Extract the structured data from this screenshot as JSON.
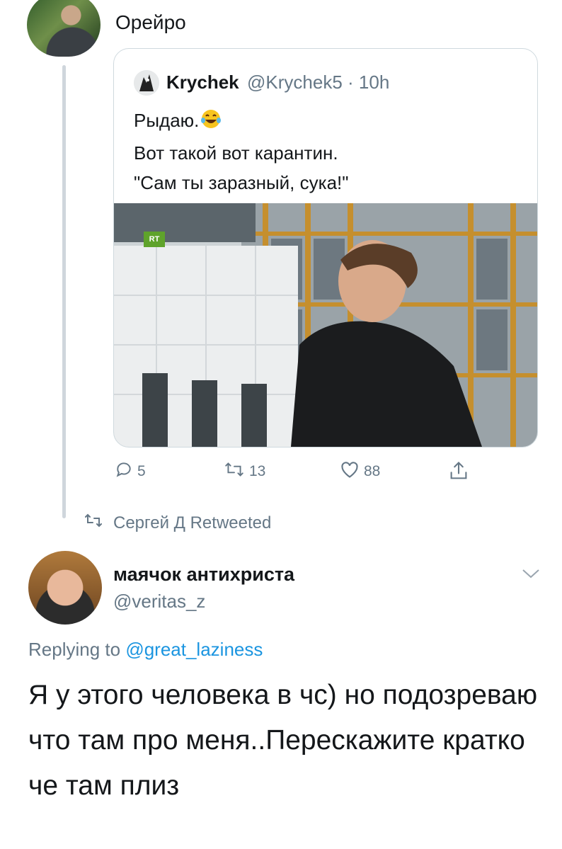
{
  "top_tweet": {
    "name": "Орейро"
  },
  "quoted_tweet": {
    "author_name": "Krychek",
    "author_handle": "@Krychek5",
    "time": "· 10h",
    "text_line1": "Рыдаю.",
    "text_line2": "Вот такой вот карантин.",
    "text_line3": "\"Сам ты заразный, сука!\"",
    "media_logo": "RT"
  },
  "actions": {
    "replies": "5",
    "retweets": "13",
    "likes": "88"
  },
  "retweet_label": "Сергей Д Retweeted",
  "tweet": {
    "author_name": "маячок антихриста",
    "author_handle": "@veritas_z",
    "replying_prefix": "Replying to",
    "replying_handle": "@great_laziness",
    "text": "Я у этого человека в чс) но подозреваю что там про меня..Перескажите кратко че там плиз"
  },
  "icons": {
    "reply": "reply-icon",
    "retweet": "retweet-icon",
    "like": "like-icon",
    "share": "share-icon",
    "chevron": "chevron-down-icon",
    "emoji": "laughing-tears-emoji"
  },
  "colors": {
    "text_primary": "#14171a",
    "text_secondary": "#657786",
    "link": "#1b95e0",
    "border": "#cfd9de"
  }
}
